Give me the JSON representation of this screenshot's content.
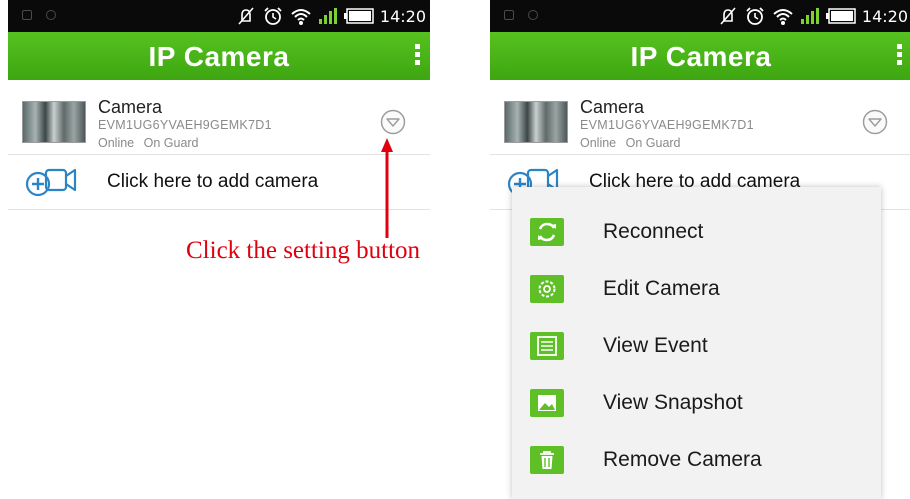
{
  "status_bar": {
    "time": "14:20"
  },
  "app_bar": {
    "title": "IP Camera"
  },
  "camera": {
    "name": "Camera",
    "id": "EVM1UG6YVAEH9GEMK7D1",
    "status_online": "Online",
    "status_guard": "On Guard"
  },
  "add_camera": {
    "label": "Click here to add camera"
  },
  "annotation": {
    "text": "Click the setting button",
    "color": "#e0000e"
  },
  "context_menu": {
    "items": [
      {
        "label": "Reconnect",
        "icon": "reconnect-icon"
      },
      {
        "label": "Edit Camera",
        "icon": "gear-icon"
      },
      {
        "label": "View Event",
        "icon": "list-icon"
      },
      {
        "label": "View Snapshot",
        "icon": "image-icon"
      },
      {
        "label": "Remove Camera",
        "icon": "trash-icon"
      }
    ]
  },
  "colors": {
    "accent": "#4cb51a",
    "menu_icon_bg": "#5fbf27"
  }
}
